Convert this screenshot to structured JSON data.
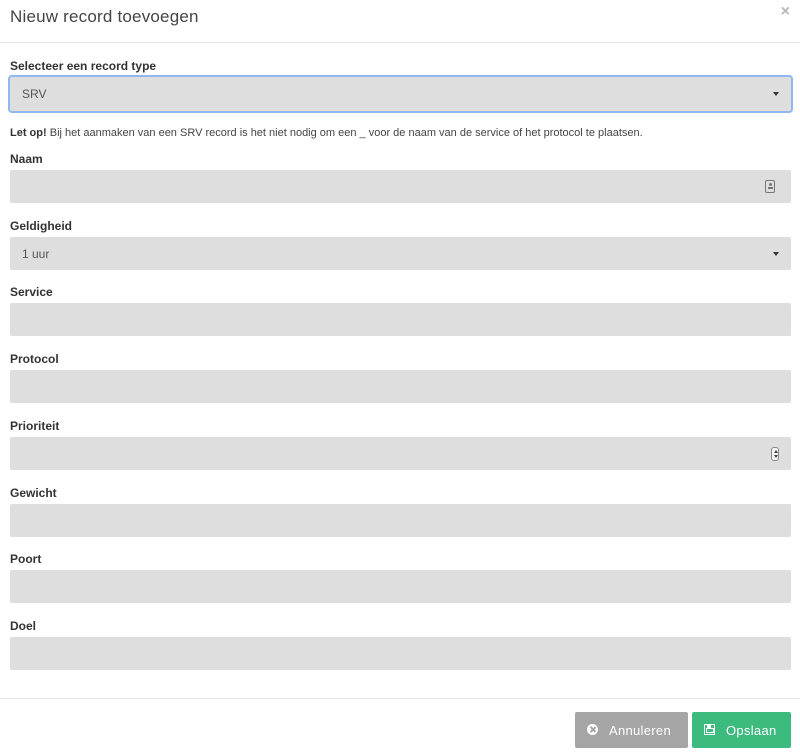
{
  "header": {
    "title": "Nieuw record toevoegen",
    "close_label": "×"
  },
  "record_type": {
    "label": "Selecteer een record type",
    "value": "SRV"
  },
  "note": {
    "emphasis": "Let op!",
    "text": " Bij het aanmaken van een SRV record is het niet nodig om een _ voor de naam van de service of het protocol te plaatsen."
  },
  "fields": {
    "naam": {
      "label": "Naam",
      "value": "",
      "icon": "contact-card-icon"
    },
    "geldigheid": {
      "label": "Geldigheid",
      "value": "1 uur"
    },
    "service": {
      "label": "Service",
      "value": ""
    },
    "protocol": {
      "label": "Protocol",
      "value": ""
    },
    "prioriteit": {
      "label": "Prioriteit",
      "value": "",
      "icon": "number-spinner-icon"
    },
    "gewicht": {
      "label": "Gewicht",
      "value": ""
    },
    "poort": {
      "label": "Poort",
      "value": ""
    },
    "doel": {
      "label": "Doel",
      "value": ""
    }
  },
  "footer": {
    "cancel_label": "Annuleren",
    "save_label": "Opslaan",
    "cancel_color": "#a5a5a5",
    "save_color": "#3dbb7f"
  }
}
